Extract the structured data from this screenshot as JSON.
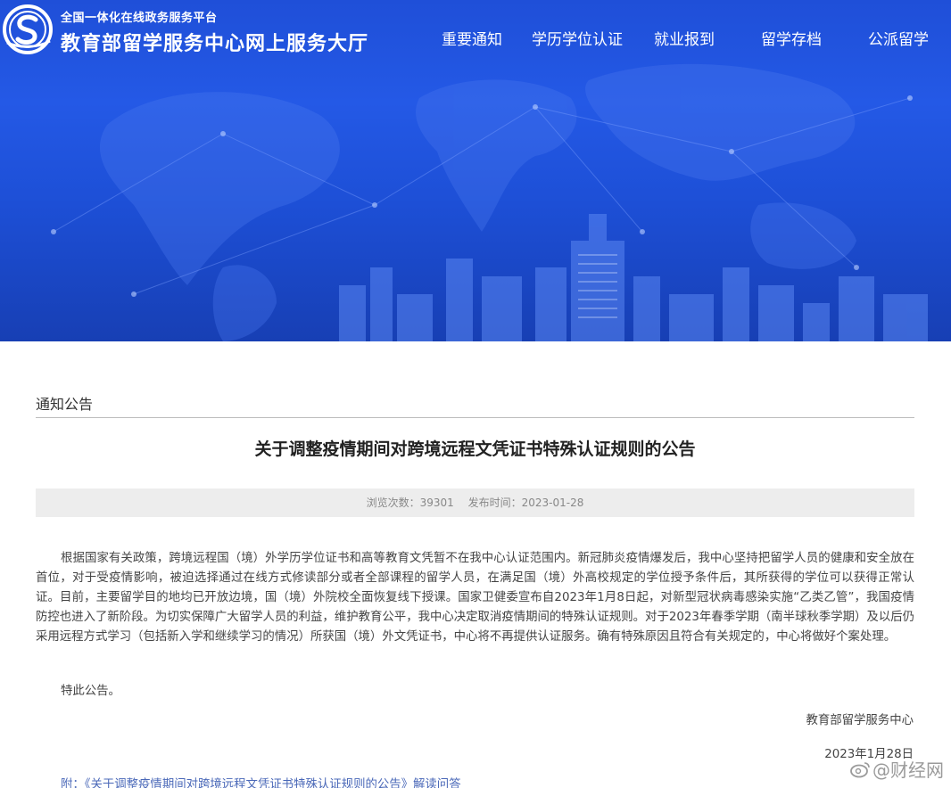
{
  "header": {
    "subtitle": "全国一体化在线政务服务平台",
    "title": "教育部留学服务中心网上服务大厅"
  },
  "nav": {
    "items": [
      {
        "label": "重要通知"
      },
      {
        "label": "学历学位认证"
      },
      {
        "label": "就业报到"
      },
      {
        "label": "留学存档"
      },
      {
        "label": "公派留学"
      }
    ]
  },
  "section": {
    "label": "通知公告"
  },
  "article": {
    "title": "关于调整疫情期间对跨境远程文凭证书特殊认证规则的公告",
    "meta": {
      "views_label": "浏览次数：",
      "views": "39301",
      "date_label": "发布时间：",
      "date": "2023-01-28"
    },
    "body": "根据国家有关政策，跨境远程国（境）外学历学位证书和高等教育文凭暂不在我中心认证范围内。新冠肺炎疫情爆发后，我中心坚持把留学人员的健康和安全放在首位，对于受疫情影响，被迫选择通过在线方式修读部分或者全部课程的留学人员，在满足国（境）外高校规定的学位授予条件后，其所获得的学位可以获得正常认证。目前，主要留学目的地均已开放边境，国（境）外院校全面恢复线下授课。国家卫健委宣布自2023年1月8日起，对新型冠状病毒感染实施“乙类乙管”，我国疫情防控也进入了新阶段。为切实保障广大留学人员的利益，维护教育公平，我中心决定取消疫情期间的特殊认证规则。对于2023年春季学期（南半球秋季学期）及以后仍采用远程方式学习（包括新入学和继续学习的情况）所获国（境）外文凭证书，中心将不再提供认证服务。确有特殊原因且符合有关规定的，中心将做好个案处理。",
    "closing": "特此公告。",
    "signature_org": "教育部留学服务中心",
    "signature_date": "2023年1月28日",
    "attachment": "附：《关于调整疫情期间对跨境远程文凭证书特殊认证规则的公告》解读问答"
  },
  "watermark": {
    "text": "@财经网"
  },
  "colors": {
    "banner": "#2459e6",
    "meta_bar": "#ededed",
    "link": "#4a68b8"
  }
}
